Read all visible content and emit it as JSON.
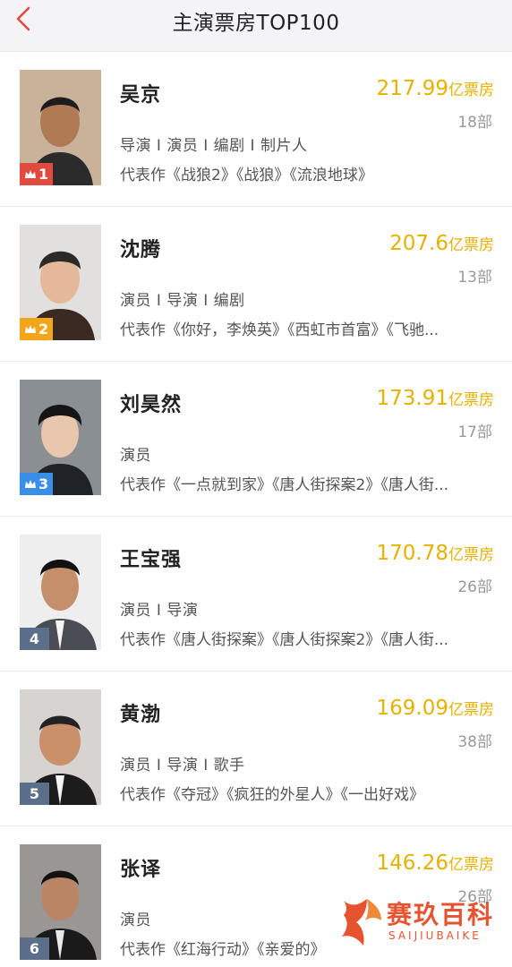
{
  "header": {
    "title": "主演票房TOP100",
    "back_icon": "chevron-left-icon",
    "accent_color": "#e14a3f"
  },
  "actors": [
    {
      "rank": "1",
      "badge_color": "#e14a3f",
      "name": "吴京",
      "box_office": "217.99",
      "unit": "亿票房",
      "works": "18部",
      "roles": "导演 I 演员 I 编剧 I 制片人",
      "rep": "代表作《战狼2》《战狼》《流浪地球》"
    },
    {
      "rank": "2",
      "badge_color": "#f2a71b",
      "name": "沈腾",
      "box_office": "207.6",
      "unit": "亿票房",
      "works": "13部",
      "roles": "演员 I 导演 I 编剧",
      "rep": "代表作《你好，李焕英》《西虹市首富》《飞驰..."
    },
    {
      "rank": "3",
      "badge_color": "#3b8ee6",
      "name": "刘昊然",
      "box_office": "173.91",
      "unit": "亿票房",
      "works": "17部",
      "roles": "演员",
      "rep": "代表作《一点就到家》《唐人街探案2》《唐人街..."
    },
    {
      "rank": "4",
      "badge_color": "#5b6f8a",
      "name": "王宝强",
      "box_office": "170.78",
      "unit": "亿票房",
      "works": "26部",
      "roles": "演员 I 导演",
      "rep": "代表作《唐人街探案》《唐人街探案2》《唐人街..."
    },
    {
      "rank": "5",
      "badge_color": "#5b6f8a",
      "name": "黄渤",
      "box_office": "169.09",
      "unit": "亿票房",
      "works": "38部",
      "roles": "演员 I 导演 I 歌手",
      "rep": "代表作《夺冠》《疯狂的外星人》《一出好戏》"
    },
    {
      "rank": "6",
      "badge_color": "#5b6f8a",
      "name": "张译",
      "box_office": "146.26",
      "unit": "亿票房",
      "works": "26部",
      "roles": "演员",
      "rep": "代表作《红海行动》《亲爱的》"
    }
  ],
  "watermark": {
    "cn": "赛玖百科",
    "en": "SAIJIUBAIKE",
    "color": "#e8532f"
  }
}
